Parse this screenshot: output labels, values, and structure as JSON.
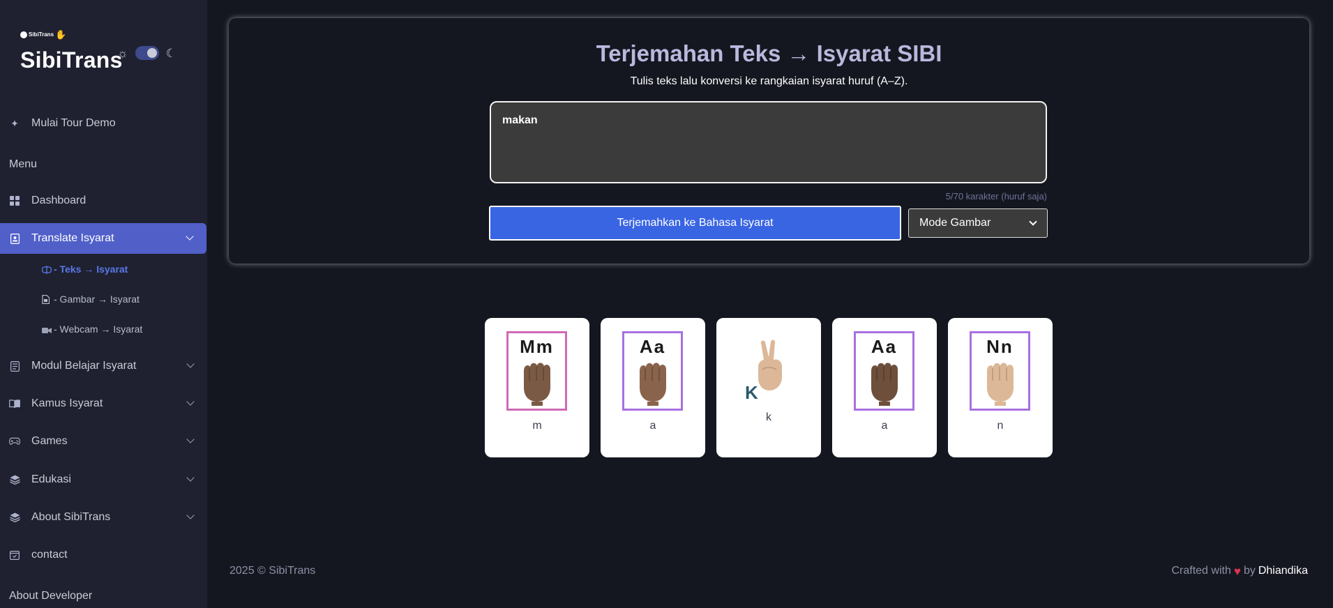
{
  "brand": {
    "small": "SibiTrans",
    "name": "SibiTrans"
  },
  "sidebar": {
    "tour": "Mulai Tour Demo",
    "menu_label": "Menu",
    "items": [
      {
        "label": "Dashboard"
      },
      {
        "label": "Translate Isyarat"
      },
      {
        "label": "Modul Belajar Isyarat"
      },
      {
        "label": "Kamus Isyarat"
      },
      {
        "label": "Games"
      },
      {
        "label": "Edukasi"
      },
      {
        "label": "About SibiTrans"
      },
      {
        "label": "contact"
      }
    ],
    "sub_items": [
      {
        "label": "- Teks → Isyarat"
      },
      {
        "label": "- Gambar → Isyarat"
      },
      {
        "label": "- Webcam → Isyarat"
      }
    ],
    "about_dev": "About Developer"
  },
  "main": {
    "title": "Terjemahan Teks → Isyarat SIBI",
    "subtitle": "Tulis teks lalu konversi ke rangkaian isyarat huruf (A–Z).",
    "input_value": "makan",
    "counter": "5/70 karakter (huruf saja)",
    "translate_label": "Terjemahkan ke Bahasa Isyarat",
    "mode_selected": "Mode Gambar"
  },
  "signs": [
    {
      "letters": "Mm",
      "label": "m"
    },
    {
      "letters": "Aa",
      "label": "a"
    },
    {
      "letters": "K",
      "label": "k"
    },
    {
      "letters": "Aa",
      "label": "a"
    },
    {
      "letters": "Nn",
      "label": "n"
    }
  ],
  "footer": {
    "copyright": "2025 © SibiTrans",
    "crafted": "Crafted with",
    "by": "by",
    "author": "Dhiandika"
  },
  "colors": {
    "accent": "#5160c9",
    "button": "#3965e3",
    "background": "#151720",
    "sidebar": "#1f2130"
  }
}
